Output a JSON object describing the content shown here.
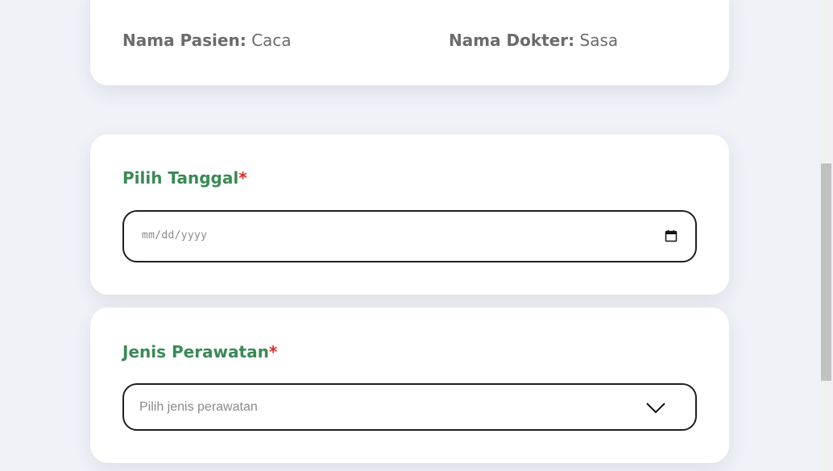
{
  "info": {
    "patient_label": "Nama Pasien:",
    "patient_value": "Caca",
    "doctor_label": "Nama Dokter:",
    "doctor_value": "Sasa"
  },
  "date_field": {
    "label": "Pilih Tanggal",
    "required_mark": "*",
    "placeholder": "mm/dd/yyyy",
    "icon": "calendar-icon"
  },
  "treatment_field": {
    "label": "Jenis Perawatan",
    "required_mark": "*",
    "placeholder": "Pilih jenis perawatan",
    "icon": "chevron-down-icon"
  },
  "colors": {
    "accent_green": "#3a8a55",
    "required_red": "#e02424",
    "background": "#eff2f7"
  }
}
